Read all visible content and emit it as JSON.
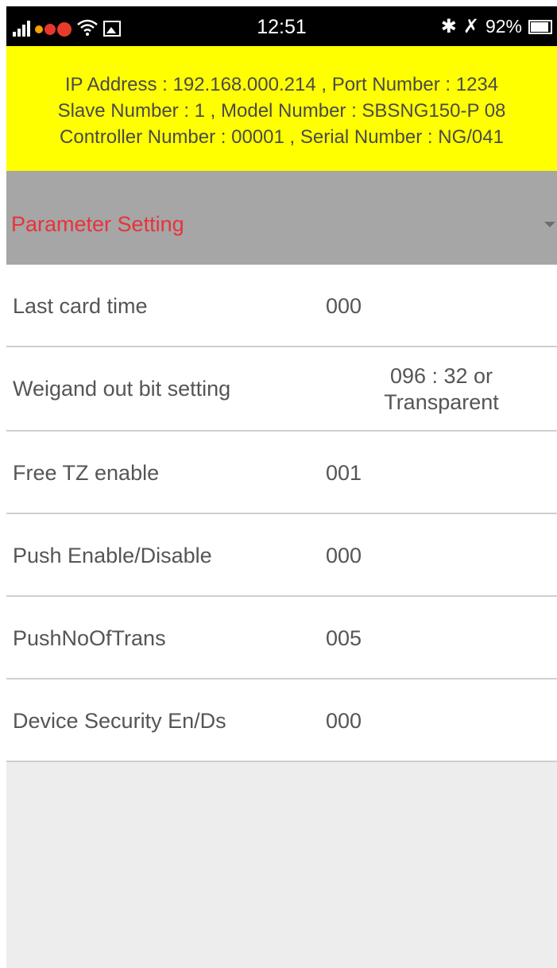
{
  "status_bar": {
    "time": "12:51",
    "battery_text": "92%",
    "battery_level": 0.92,
    "icons": [
      "signal-icon",
      "notification-icon",
      "wifi-icon",
      "gallery-icon",
      "bluetooth-icon",
      "mute-icon",
      "battery-icon"
    ]
  },
  "device_info": {
    "line1": "IP Address : 192.168.000.214 , Port Number : 1234",
    "line2": "Slave Number : 1 , Model Number :    SBSNG150-P 08",
    "line3": "Controller Number : 00001 , Serial Number : NG/041"
  },
  "section": {
    "title": "Parameter Setting"
  },
  "parameters": [
    {
      "label": "Last card time",
      "value": "000"
    },
    {
      "label": "Weigand out bit setting",
      "value": "096 : 32 or Transparent"
    },
    {
      "label": "Free TZ enable",
      "value": "001"
    },
    {
      "label": "Push Enable/Disable",
      "value": "000"
    },
    {
      "label": "PushNoOfTrans",
      "value": "005"
    },
    {
      "label": "Device Security En/Ds",
      "value": "000"
    }
  ],
  "colors": {
    "banner": "#ffff00",
    "section_bg": "#a6a6a6",
    "section_title": "#e8333a"
  }
}
